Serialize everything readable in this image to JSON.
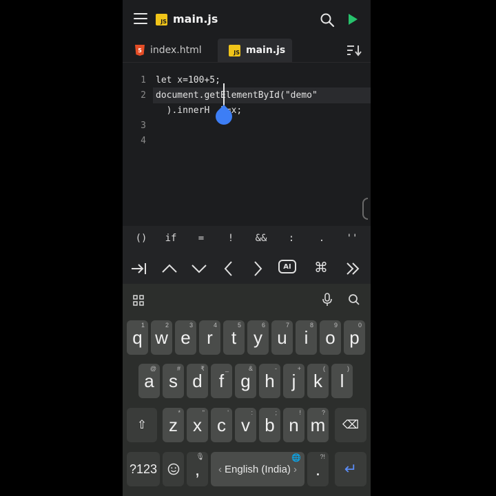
{
  "app": {
    "title": "main.js",
    "js_badge": "JS",
    "accent": "#27c26c"
  },
  "tabs": [
    {
      "label": "index.html",
      "badge": "5",
      "active": false
    },
    {
      "label": "main.js",
      "badge": "JS",
      "active": true
    }
  ],
  "editor": {
    "line_numbers": [
      "1",
      "2",
      "3",
      "4"
    ],
    "lines": [
      "let x=100+5;",
      "document.getElementById(\"demo\"",
      "  ).innerHTML=x;",
      ""
    ],
    "visible_line3": "  ).innerH",
    "visible_line3_tail": "L=x;"
  },
  "symbols": [
    "()",
    "if",
    "=",
    "!",
    "&&",
    ":",
    ".",
    "''"
  ],
  "toolbar": {
    "icons": [
      "tab-icon",
      "arrow-up-icon",
      "arrow-down-icon",
      "arrow-left-icon",
      "arrow-right-icon",
      "ai-icon",
      "command-icon",
      "fast-forward-icon"
    ],
    "ai_label": "AI"
  },
  "keyboard": {
    "row1": [
      {
        "k": "q",
        "h": "1"
      },
      {
        "k": "w",
        "h": "2"
      },
      {
        "k": "e",
        "h": "3"
      },
      {
        "k": "r",
        "h": "4"
      },
      {
        "k": "t",
        "h": "5"
      },
      {
        "k": "y",
        "h": "6"
      },
      {
        "k": "u",
        "h": "7"
      },
      {
        "k": "i",
        "h": "8"
      },
      {
        "k": "o",
        "h": "9"
      },
      {
        "k": "p",
        "h": "0"
      }
    ],
    "row2": [
      {
        "k": "a",
        "h": "@"
      },
      {
        "k": "s",
        "h": "#"
      },
      {
        "k": "d",
        "h": "₹"
      },
      {
        "k": "f",
        "h": "_"
      },
      {
        "k": "g",
        "h": "&"
      },
      {
        "k": "h",
        "h": "-"
      },
      {
        "k": "j",
        "h": "+"
      },
      {
        "k": "k",
        "h": "("
      },
      {
        "k": "l",
        "h": ")"
      }
    ],
    "row3": [
      {
        "k": "z",
        "h": "*"
      },
      {
        "k": "x",
        "h": "\""
      },
      {
        "k": "c",
        "h": "'"
      },
      {
        "k": "v",
        "h": ":"
      },
      {
        "k": "b",
        "h": ";"
      },
      {
        "k": "n",
        "h": "!"
      },
      {
        "k": "m",
        "h": "?"
      }
    ],
    "symbols_key": "?123",
    "comma": ",",
    "period": ".",
    "space_label": "English (India)",
    "space_left": "‹",
    "space_right": "›",
    "enter": "↵",
    "shift": "⇧",
    "backspace": "⌫"
  }
}
